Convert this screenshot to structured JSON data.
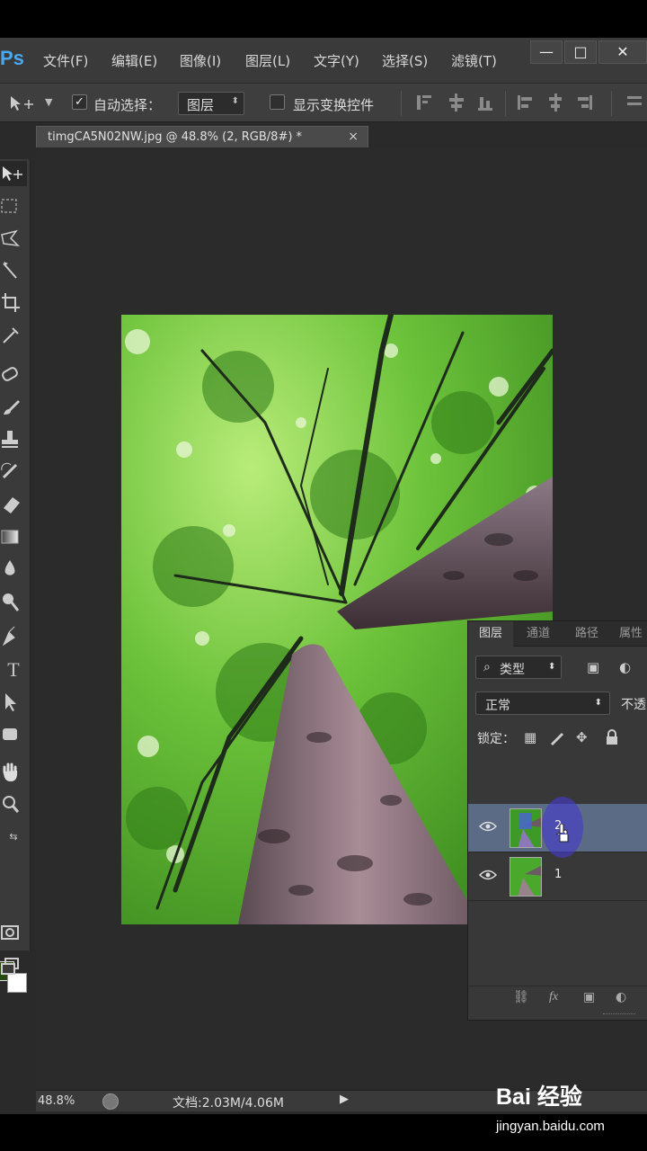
{
  "app": {
    "logo": "Ps"
  },
  "menu": [
    "文件(F)",
    "编辑(E)",
    "图像(I)",
    "图层(L)",
    "文字(Y)",
    "选择(S)",
    "滤镜(T)"
  ],
  "window_controls": {
    "minimize": "—",
    "maximize": "□",
    "close": "✕"
  },
  "options_bar": {
    "tool_icon": "move-tool-icon",
    "auto_select_label": "自动选择：",
    "auto_select_checked": true,
    "auto_select_value": "图层",
    "show_transform_label": "显示变换控件",
    "show_transform_checked": false
  },
  "document_tab": {
    "title": "timgCA5N02NW.jpg @ 48.8% (2, RGB/8#) *",
    "close": "×"
  },
  "toolbox": {
    "tools": [
      "move-tool-icon",
      "marquee-tool-icon",
      "lasso-tool-icon",
      "magic-wand-icon",
      "crop-tool-icon",
      "eyedropper-icon",
      "healing-brush-icon",
      "brush-tool-icon",
      "clone-stamp-icon",
      "history-brush-icon",
      "eraser-icon",
      "gradient-tool-icon",
      "blur-tool-icon",
      "dodge-tool-icon",
      "pen-tool-icon",
      "type-tool-icon",
      "path-select-icon",
      "shape-tool-icon",
      "hand-tool-icon",
      "zoom-tool-icon",
      "quick-mask-icon",
      "screen-mode-icon"
    ],
    "foreground_color": "#254a12",
    "background_color": "#ffffff",
    "type_glyph": "T"
  },
  "layers_panel": {
    "tabs": [
      "图层",
      "通道",
      "路径",
      "属性"
    ],
    "filter_label": "类型",
    "filter_icon": "⌕",
    "blend_mode": "正常",
    "opacity_label": "不透",
    "lock_label": "锁定：",
    "layers": [
      {
        "name": "2",
        "visible": true,
        "selected": true
      },
      {
        "name": "1",
        "visible": true,
        "selected": false
      }
    ],
    "bottom_fx": "fx"
  },
  "status_bar": {
    "zoom": "48.8%",
    "doc_info": "文档:2.03M/4.06M"
  },
  "watermark": {
    "logo": "Bai 经验",
    "url": "jingyan.baidu.com"
  }
}
